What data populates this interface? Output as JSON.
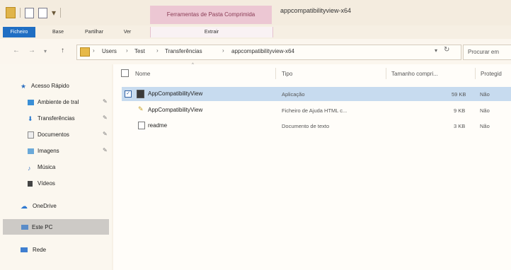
{
  "window": {
    "title": "appcompatibilityview-x64"
  },
  "ribbon": {
    "tool_tab_header": "Ferramentas de Pasta Comprimida",
    "tabs": [
      "Ficheiro",
      "Base",
      "Partilhar",
      "Ver",
      "Extrair"
    ]
  },
  "address": {
    "crumbs": [
      "Users",
      "Test",
      "Transferências",
      "appcompatibilityview-x64"
    ],
    "search_placeholder": "Procurar em"
  },
  "sidebar": {
    "quick_access": "Acesso Rápido",
    "items": [
      "Ambiente de tral",
      "Transferências",
      "Documentos",
      "Imagens",
      "Música",
      "Vídeos"
    ],
    "onedrive": "OneDrive",
    "this_pc": "Este PC",
    "network": "Rede"
  },
  "columns": [
    "Nome",
    "Tipo",
    "Tamanho compri...",
    "Protegid"
  ],
  "files": [
    {
      "name": "AppCompatibilityView",
      "type": "Aplicação",
      "size": "59 KB",
      "protected": "Não"
    },
    {
      "name": "AppCompatibilityView",
      "type": "Ficheiro de Ajuda HTML c...",
      "size": "9 KB",
      "protected": "Não"
    },
    {
      "name": "readme",
      "type": "Documento de texto",
      "size": "3 KB",
      "protected": "Não"
    }
  ],
  "colors": {
    "accent": "#1f6ec3",
    "tool_tab": "#ecc7d3",
    "selection": "#c7dbef"
  }
}
